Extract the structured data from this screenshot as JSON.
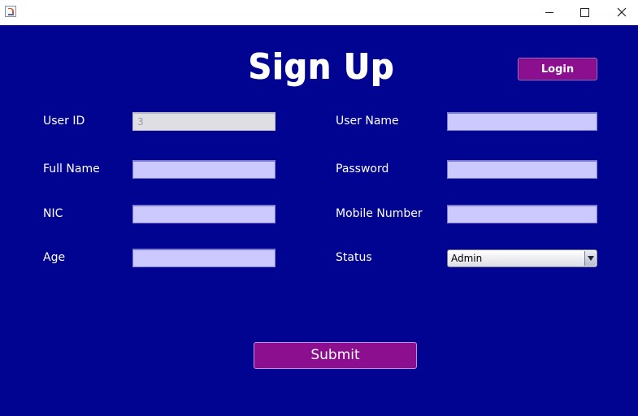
{
  "window": {
    "icon": "java-icon",
    "controls": [
      "minimize-icon",
      "maximize-icon",
      "close-icon"
    ]
  },
  "form": {
    "title": "Sign Up",
    "login_label": "Login",
    "submit_label": "Submit",
    "user_id": {
      "label": "User ID",
      "value": "3"
    },
    "full_name": {
      "label": "Full Name",
      "value": ""
    },
    "nic": {
      "label": "NIC",
      "value": ""
    },
    "age": {
      "label": "Age",
      "value": ""
    },
    "user_name": {
      "label": "User Name",
      "value": ""
    },
    "password": {
      "label": "Password",
      "value": ""
    },
    "mobile_number": {
      "label": "Mobile Number",
      "value": ""
    },
    "status": {
      "label": "Status",
      "selected": "Admin"
    }
  },
  "colors": {
    "background": "#010491",
    "button": "#8b0f8f",
    "field": "#cbc9ff",
    "text": "#ffffff"
  }
}
